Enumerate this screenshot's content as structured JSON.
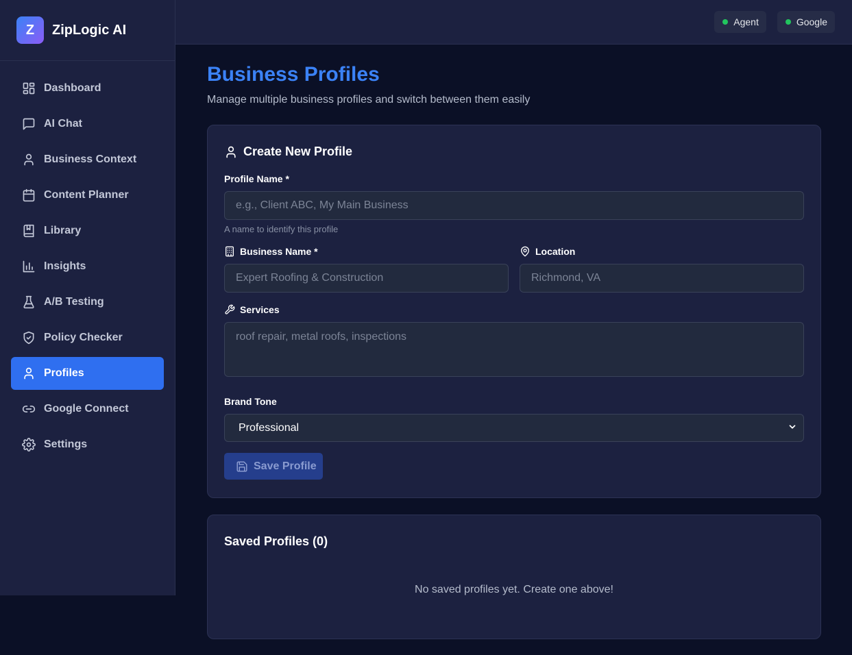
{
  "app": {
    "logo_letter": "Z",
    "name": "ZipLogic AI"
  },
  "sidebar": {
    "items": [
      {
        "label": "Dashboard",
        "icon": "dashboard-icon",
        "active": false
      },
      {
        "label": "AI Chat",
        "icon": "chat-icon",
        "active": false
      },
      {
        "label": "Business Context",
        "icon": "user-icon",
        "active": false
      },
      {
        "label": "Content Planner",
        "icon": "calendar-icon",
        "active": false
      },
      {
        "label": "Library",
        "icon": "book-icon",
        "active": false
      },
      {
        "label": "Insights",
        "icon": "bar-chart-icon",
        "active": false
      },
      {
        "label": "A/B Testing",
        "icon": "flask-icon",
        "active": false
      },
      {
        "label": "Policy Checker",
        "icon": "shield-check-icon",
        "active": false
      },
      {
        "label": "Profiles",
        "icon": "user-icon",
        "active": true
      },
      {
        "label": "Google Connect",
        "icon": "link-icon",
        "active": false
      },
      {
        "label": "Settings",
        "icon": "gear-icon",
        "active": false
      }
    ]
  },
  "topbar": {
    "statuses": [
      {
        "label": "Agent",
        "color": "#22c55e"
      },
      {
        "label": "Google",
        "color": "#22c55e"
      }
    ]
  },
  "page": {
    "title": "Business Profiles",
    "subtitle": "Manage multiple business profiles and switch between them easily"
  },
  "create_form": {
    "title": "Create New Profile",
    "profile_name": {
      "label": "Profile Name *",
      "value": "",
      "placeholder": "e.g., Client ABC, My Main Business",
      "hint": "A name to identify this profile"
    },
    "business_name": {
      "label": "Business Name *",
      "value": "",
      "placeholder": "Expert Roofing & Construction"
    },
    "location": {
      "label": "Location",
      "value": "",
      "placeholder": "Richmond, VA"
    },
    "services": {
      "label": "Services",
      "value": "",
      "placeholder": "roof repair, metal roofs, inspections"
    },
    "brand_tone": {
      "label": "Brand Tone",
      "selected": "Professional"
    },
    "save_label": "Save Profile"
  },
  "saved_profiles": {
    "title": "Saved Profiles (0)",
    "empty_message": "No saved profiles yet. Create one above!"
  },
  "colors": {
    "accent": "#3b82f6",
    "active_nav": "#2f6ff0",
    "status_ok": "#22c55e",
    "background": "#0b1026",
    "panel": "#1c2140"
  }
}
